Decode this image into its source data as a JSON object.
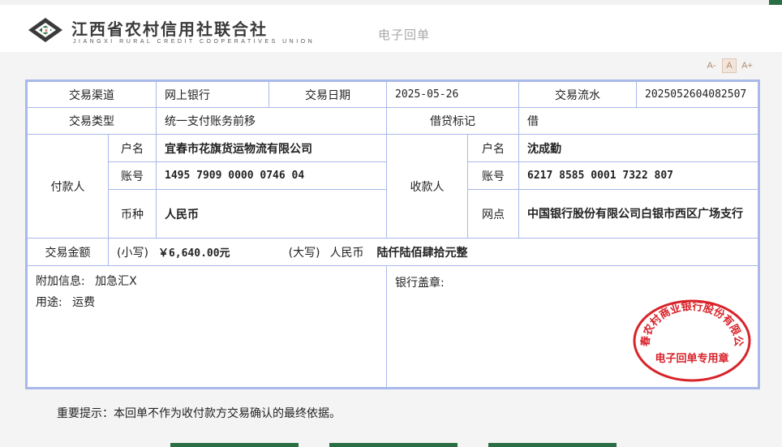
{
  "header": {
    "org_name": "江西省农村信用社联合社",
    "org_en": "JIANGXI RURAL CREDIT COOPERATIVES UNION",
    "receipt_title": "电子回单",
    "font_tools": [
      "A-",
      "A",
      "A+"
    ]
  },
  "row1": {
    "channel_label": "交易渠道",
    "channel_value": "网上银行",
    "date_label": "交易日期",
    "date_value": "2025-05-26",
    "serial_label": "交易流水",
    "serial_value": "2025052604082507"
  },
  "row2": {
    "type_label": "交易类型",
    "type_value": "统一支付账务前移",
    "dc_label": "借贷标记",
    "dc_value": "借"
  },
  "payer": {
    "label": "付款人",
    "name_label": "户名",
    "name_value": "宜春市花旗货运物流有限公司",
    "account_label": "账号",
    "account_value": "1495 7909 0000 0746 04",
    "currency_label": "币种",
    "currency_value": "人民币"
  },
  "payee": {
    "label": "收款人",
    "name_label": "户名",
    "name_value": "沈成勤",
    "account_label": "账号",
    "account_value": "6217 8585 0001 7322 807",
    "branch_label": "网点",
    "branch_value": "中国银行股份有限公司白银市西区广场支行"
  },
  "amount": {
    "label": "交易金额",
    "small_label": "(小写)",
    "small_value": "￥6,640.00元",
    "big_label": "(大写)",
    "big_currency": "人民币",
    "big_value": "陆仟陆佰肆拾元整"
  },
  "extra": {
    "info_label": "附加信息:",
    "info_value": "加急汇X",
    "usage_label": "用途:",
    "usage_value": "运费",
    "seal_label": "银行盖章:"
  },
  "stamp": {
    "ring_text": "宜春农村商业银行股份有限公司",
    "center_text": "电子回单专用章",
    "color": "#d8232a"
  },
  "notice": "重要提示：本回单不作为收付款方交易确认的最终依据。"
}
